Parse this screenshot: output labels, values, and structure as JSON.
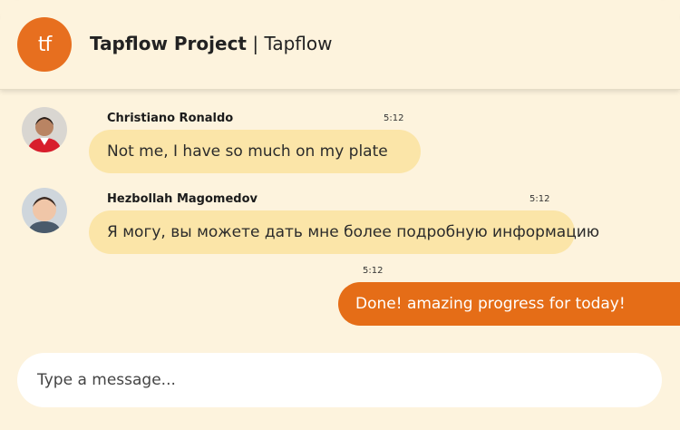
{
  "header": {
    "logo_text": "tf",
    "project_name": "Tapflow Project",
    "separator": "|",
    "app_name": "Tapflow"
  },
  "messages": [
    {
      "sender": "Christiano Ronaldo",
      "time": "5:12",
      "text": "Not me, I have so much on my plate",
      "avatar_icon": "user-photo-icon",
      "direction": "incoming"
    },
    {
      "sender": "Hezbollah Magomedov",
      "time": "5:12",
      "text": "Я могу, вы можете дать мне более подробную информацию",
      "avatar_icon": "user-photo-icon",
      "direction": "incoming"
    },
    {
      "sender": "",
      "time": "5:12",
      "text": "Done! amazing progress for today!",
      "direction": "outgoing"
    }
  ],
  "composer": {
    "placeholder": "Type a message..."
  },
  "colors": {
    "background": "#fdf3dd",
    "accent": "#e56d17",
    "incoming_bubble": "#fbe5a8",
    "composer": "#ffffff"
  }
}
